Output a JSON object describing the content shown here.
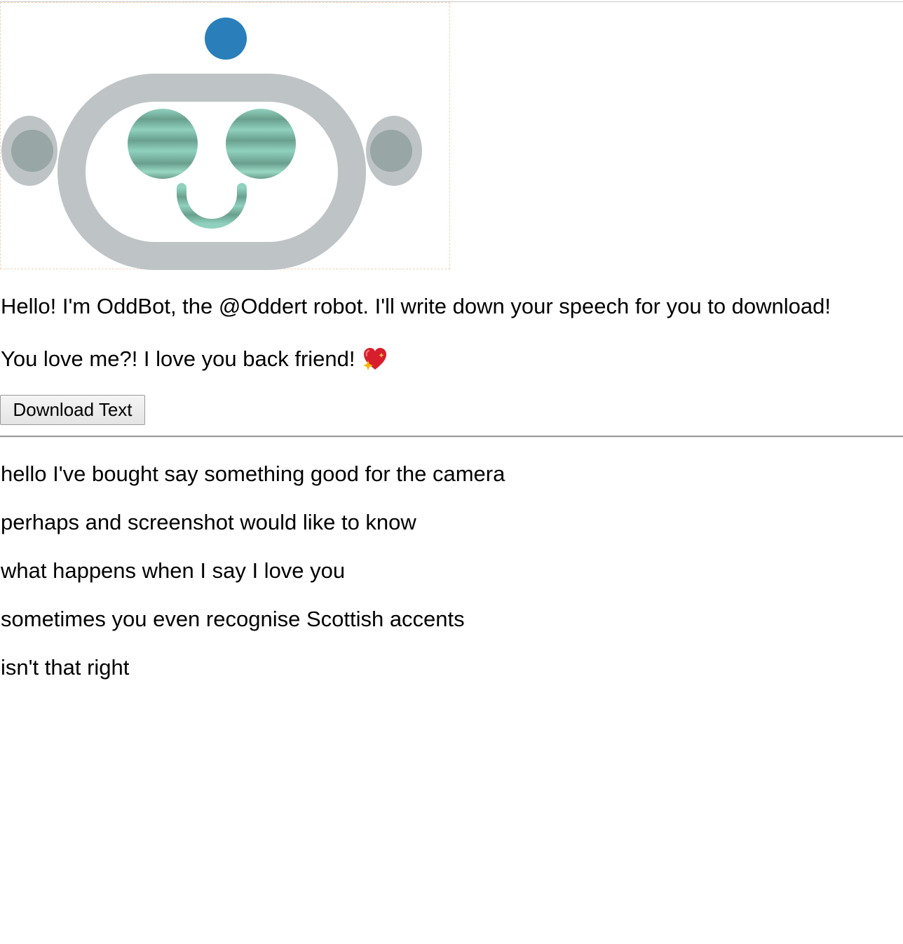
{
  "robot": {
    "name": "OddBot",
    "colors": {
      "antenna": "#2a7fbb",
      "head": "#bec3c6",
      "ear_inner": "#98a6a5",
      "eyes": "#8fd1bd",
      "eyes_dark": "#6a9f8e",
      "face": "#ffffff"
    }
  },
  "messages": {
    "greeting": "Hello! I'm OddBot, the @Oddert robot. I'll write down your speech for you to download!",
    "reply": "You love me?! I love you back friend!",
    "reply_icon": "sparkling-heart-icon"
  },
  "actions": {
    "download_label": "Download Text"
  },
  "transcript": [
    "hello I've bought say something good for the camera",
    "perhaps and screenshot would like to know",
    "what happens when I say I love you",
    "sometimes you even recognise Scottish accents",
    "isn't that right"
  ]
}
